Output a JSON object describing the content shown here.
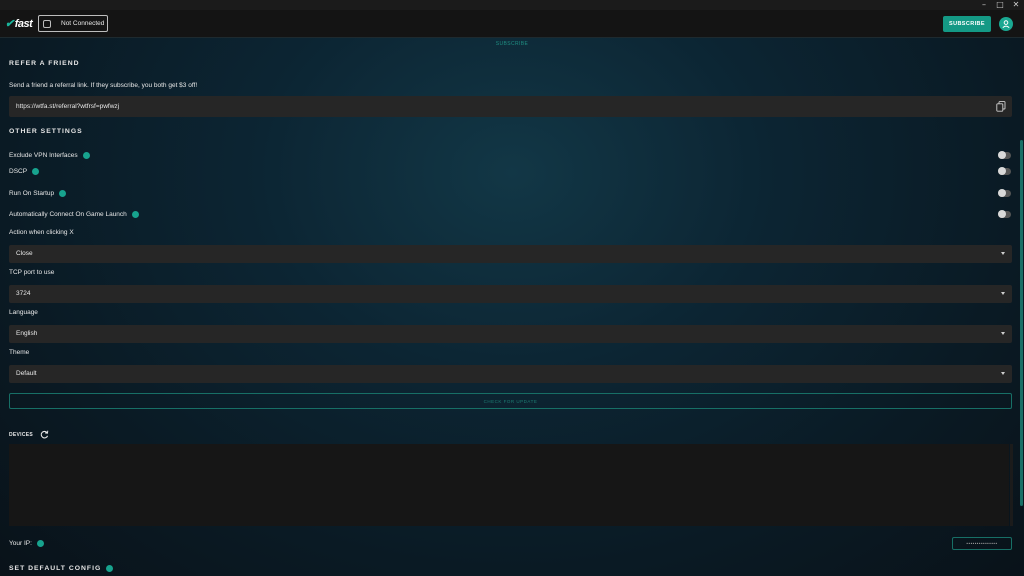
{
  "window": {
    "controls": {
      "minimize": "–",
      "maximize": "□",
      "close": "✕"
    }
  },
  "header": {
    "logo": "fast",
    "connection_label": "Not Connected",
    "subscribe_label": "SUBSCRIBE",
    "avatar_icon": "user-icon"
  },
  "top_link": "SUBSCRIBE",
  "refer": {
    "title": "REFER A FRIEND",
    "description": "Send a friend a referral link. If they subscribe, you both get $3 off!",
    "link": "https://wtfa.st/referral?wtfrsf=pwfwzj",
    "copy_icon": "copy-icon"
  },
  "other_settings": {
    "title": "OTHER SETTINGS",
    "toggles": [
      {
        "label": "Exclude VPN Interfaces",
        "on": false
      },
      {
        "label": "DSCP",
        "on": false
      },
      {
        "label": "Run On Startup",
        "on": false
      },
      {
        "label": "Automatically Connect On Game Launch",
        "on": false
      }
    ],
    "selects": [
      {
        "label": "Action when clicking X",
        "value": "Close"
      },
      {
        "label": "TCP port to use",
        "value": "3724"
      },
      {
        "label": "Language",
        "value": "English"
      },
      {
        "label": "Theme",
        "value": "Default"
      }
    ],
    "update_button": "CHECK FOR UPDATE"
  },
  "devices": {
    "title": "DEVICES",
    "refresh_icon": "refresh-icon"
  },
  "ip": {
    "label": "Your IP:",
    "value": "•••••••••••••••"
  },
  "default_config": {
    "title": "SET DEFAULT CONFIG"
  },
  "colors": {
    "accent": "#149985",
    "background": "#0c2533",
    "field": "#262626"
  }
}
